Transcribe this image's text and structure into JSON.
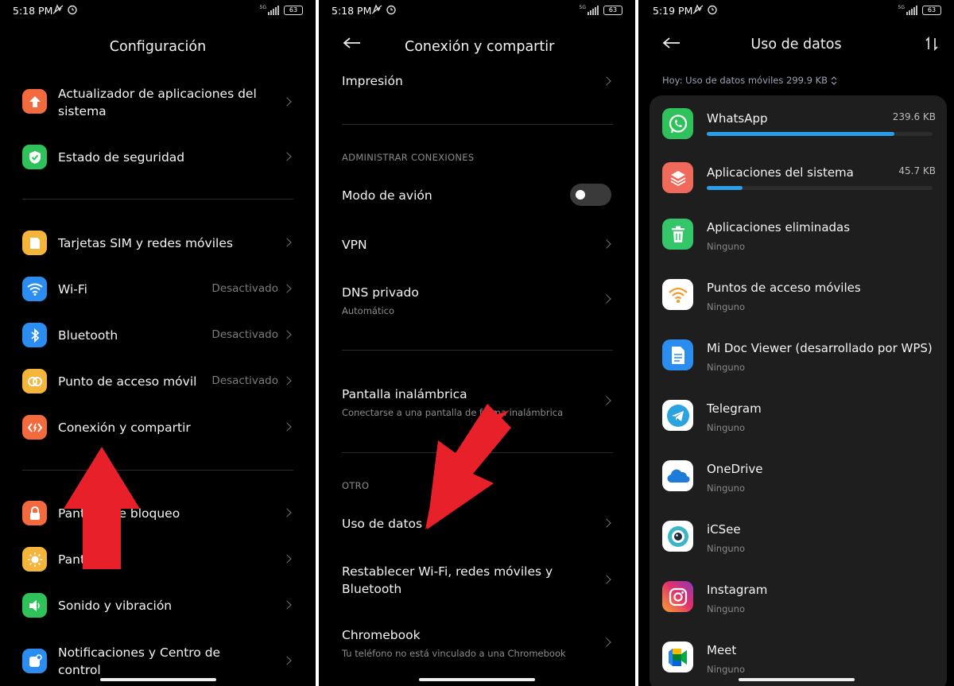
{
  "panel1": {
    "status": {
      "time": "5:18 PM",
      "battery": "63",
      "network": "5G"
    },
    "title": "Configuración",
    "items": [
      {
        "label": "Actualizador de aplicaciones del sistema",
        "value": "",
        "icon": "arrow-up-icon",
        "color": "#f26a3d"
      },
      {
        "label": "Estado de seguridad",
        "value": "",
        "icon": "shield-check-icon",
        "color": "#2fc25b"
      },
      {
        "label": "Tarjetas SIM y redes móviles",
        "value": "",
        "icon": "sim-card-icon",
        "color": "#f5b43a"
      },
      {
        "label": "Wi-Fi",
        "value": "Desactivado",
        "icon": "wifi-icon",
        "color": "#2b8df0"
      },
      {
        "label": "Bluetooth",
        "value": "Desactivado",
        "icon": "bluetooth-icon",
        "color": "#2b8df0"
      },
      {
        "label": "Punto de acceso móvil",
        "value": "Desactivado",
        "icon": "hotspot-icon",
        "color": "#f5b43a"
      },
      {
        "label": "Conexión y compartir",
        "value": "",
        "icon": "share-icon",
        "color": "#f26a3d"
      },
      {
        "label": "Pantalla de bloqueo",
        "value": "",
        "icon": "lock-icon",
        "color": "#f26a3d"
      },
      {
        "label": "Pantalla",
        "value": "",
        "icon": "sun-icon",
        "color": "#f5b43a"
      },
      {
        "label": "Sonido y vibración",
        "value": "",
        "icon": "speaker-icon",
        "color": "#2fc25b"
      },
      {
        "label": "Notificaciones y Centro de control",
        "value": "",
        "icon": "notification-icon",
        "color": "#2b8df0"
      }
    ]
  },
  "panel2": {
    "status": {
      "time": "5:18 PM",
      "battery": "63",
      "network": "5G"
    },
    "title": "Conexión y compartir",
    "print_label": "Impresión",
    "section_manage": "ADMINISTRAR CONEXIONES",
    "airplane_label": "Modo de avión",
    "airplane_on": false,
    "vpn_label": "VPN",
    "dns_label": "DNS privado",
    "dns_sub": "Automático",
    "wireless_label": "Pantalla inalámbrica",
    "wireless_sub": "Conectarse a una pantalla de forma inalámbrica",
    "section_other": "OTRO",
    "data_usage_label": "Uso de datos",
    "reset_label": "Restablecer Wi-Fi, redes móviles y Bluetooth",
    "chromebook_label": "Chromebook",
    "chromebook_sub": "Tu teléfono no está vinculado a una Chromebook"
  },
  "panel3": {
    "status": {
      "time": "5:19 PM",
      "battery": "63",
      "network": "5G"
    },
    "title": "Uso de datos",
    "today": "Hoy: Uso de datos móviles 299.9 KB",
    "apps": [
      {
        "name": "WhatsApp",
        "size": "239.6 KB",
        "usage": 0.83,
        "sub": "",
        "icon": "whatsapp-icon",
        "color": "#2fc25b"
      },
      {
        "name": "Aplicaciones del sistema",
        "size": "45.7 KB",
        "usage": 0.16,
        "sub": "",
        "icon": "layers-icon",
        "color": "#ef6a5a"
      },
      {
        "name": "Aplicaciones eliminadas",
        "size": "",
        "sub": "Ninguno",
        "icon": "trash-icon",
        "color": "#34c76a"
      },
      {
        "name": "Puntos de acceso móviles",
        "size": "",
        "sub": "Ninguno",
        "icon": "hotspot-wifi-icon",
        "color": "#ffffff"
      },
      {
        "name": "Mi Doc Viewer (desarrollado por WPS)",
        "size": "",
        "sub": "Ninguno",
        "icon": "document-icon",
        "color": "#2b8df0"
      },
      {
        "name": "Telegram",
        "size": "",
        "sub": "Ninguno",
        "icon": "telegram-icon",
        "color": "#ffffff"
      },
      {
        "name": "OneDrive",
        "size": "",
        "sub": "Ninguno",
        "icon": "cloud-icon",
        "color": "#ffffff"
      },
      {
        "name": "iCSee",
        "size": "",
        "sub": "Ninguno",
        "icon": "camera-lens-icon",
        "color": "#ffffff"
      },
      {
        "name": "Instagram",
        "size": "",
        "sub": "Ninguno",
        "icon": "instagram-icon",
        "color": "#e1306c"
      },
      {
        "name": "Meet",
        "size": "",
        "sub": "Ninguno",
        "icon": "video-call-icon",
        "color": "#ffffff"
      }
    ]
  }
}
